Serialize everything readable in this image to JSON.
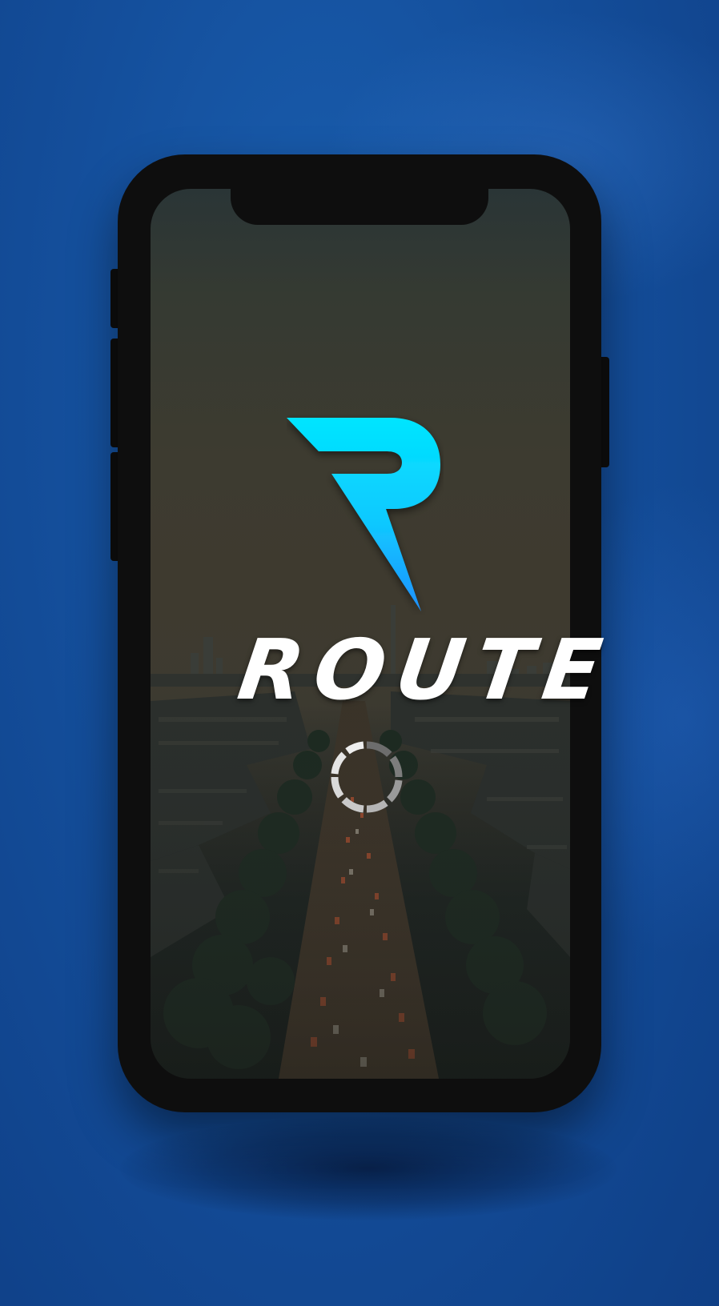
{
  "app": {
    "name": "ROUTE",
    "logo_letter": "R"
  },
  "splash": {
    "loading_indicator": "spinner-icon"
  },
  "colors": {
    "background": "#144f9c",
    "device_frame": "#0e0e0e",
    "logo_gradient_top": "#00e5ff",
    "logo_gradient_bottom": "#1e90ff",
    "wordmark": "#ffffff",
    "spinner": "#d9d9d9"
  }
}
